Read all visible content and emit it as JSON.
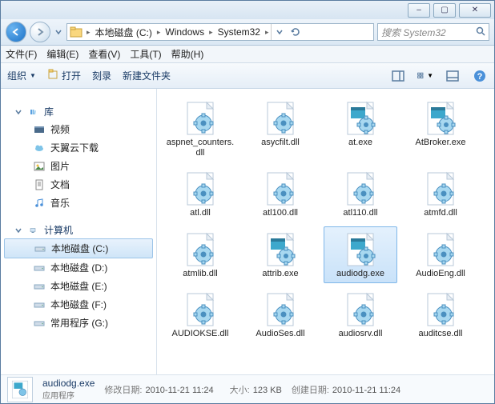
{
  "window_buttons": {
    "min": "–",
    "max": "▢",
    "close": "✕"
  },
  "address": {
    "crumbs": [
      "本地磁盘 (C:)",
      "Windows",
      "System32"
    ]
  },
  "search": {
    "placeholder": "搜索 System32"
  },
  "menu": [
    "文件(F)",
    "编辑(E)",
    "查看(V)",
    "工具(T)",
    "帮助(H)"
  ],
  "toolbar": {
    "organize": "组织",
    "open": "打开",
    "burn": "刻录",
    "newfolder": "新建文件夹"
  },
  "tree": {
    "libraries": {
      "label": "库",
      "items": [
        {
          "icon": "video",
          "label": "视频"
        },
        {
          "icon": "cloud",
          "label": "天翼云下载"
        },
        {
          "icon": "pictures",
          "label": "图片"
        },
        {
          "icon": "documents",
          "label": "文档"
        },
        {
          "icon": "music",
          "label": "音乐"
        }
      ]
    },
    "computer": {
      "label": "计算机",
      "items": [
        {
          "icon": "drive",
          "label": "本地磁盘 (C:)",
          "selected": true
        },
        {
          "icon": "drive",
          "label": "本地磁盘 (D:)"
        },
        {
          "icon": "drive",
          "label": "本地磁盘 (E:)"
        },
        {
          "icon": "drive",
          "label": "本地磁盘 (F:)"
        },
        {
          "icon": "drive",
          "label": "常用程序 (G:)"
        }
      ]
    }
  },
  "files": [
    {
      "name": "aspnet_counters.dll",
      "type": "dll"
    },
    {
      "name": "asycfilt.dll",
      "type": "dll"
    },
    {
      "name": "at.exe",
      "type": "exe"
    },
    {
      "name": "AtBroker.exe",
      "type": "exe"
    },
    {
      "name": "atl.dll",
      "type": "dll"
    },
    {
      "name": "atl100.dll",
      "type": "dll"
    },
    {
      "name": "atl110.dll",
      "type": "dll"
    },
    {
      "name": "atmfd.dll",
      "type": "dll"
    },
    {
      "name": "atmlib.dll",
      "type": "dll"
    },
    {
      "name": "attrib.exe",
      "type": "exe"
    },
    {
      "name": "audiodg.exe",
      "type": "exe",
      "selected": true
    },
    {
      "name": "AudioEng.dll",
      "type": "dll"
    },
    {
      "name": "AUDIOKSE.dll",
      "type": "dll"
    },
    {
      "name": "AudioSes.dll",
      "type": "dll"
    },
    {
      "name": "audiosrv.dll",
      "type": "dll"
    },
    {
      "name": "auditcse.dll",
      "type": "dll"
    }
  ],
  "details": {
    "name": "audiodg.exe",
    "type": "应用程序",
    "modified_label": "修改日期:",
    "modified": "2010-11-21 11:24",
    "created_label": "创建日期:",
    "created": "2010-11-21 11:24",
    "size_label": "大小:",
    "size": "123 KB"
  }
}
